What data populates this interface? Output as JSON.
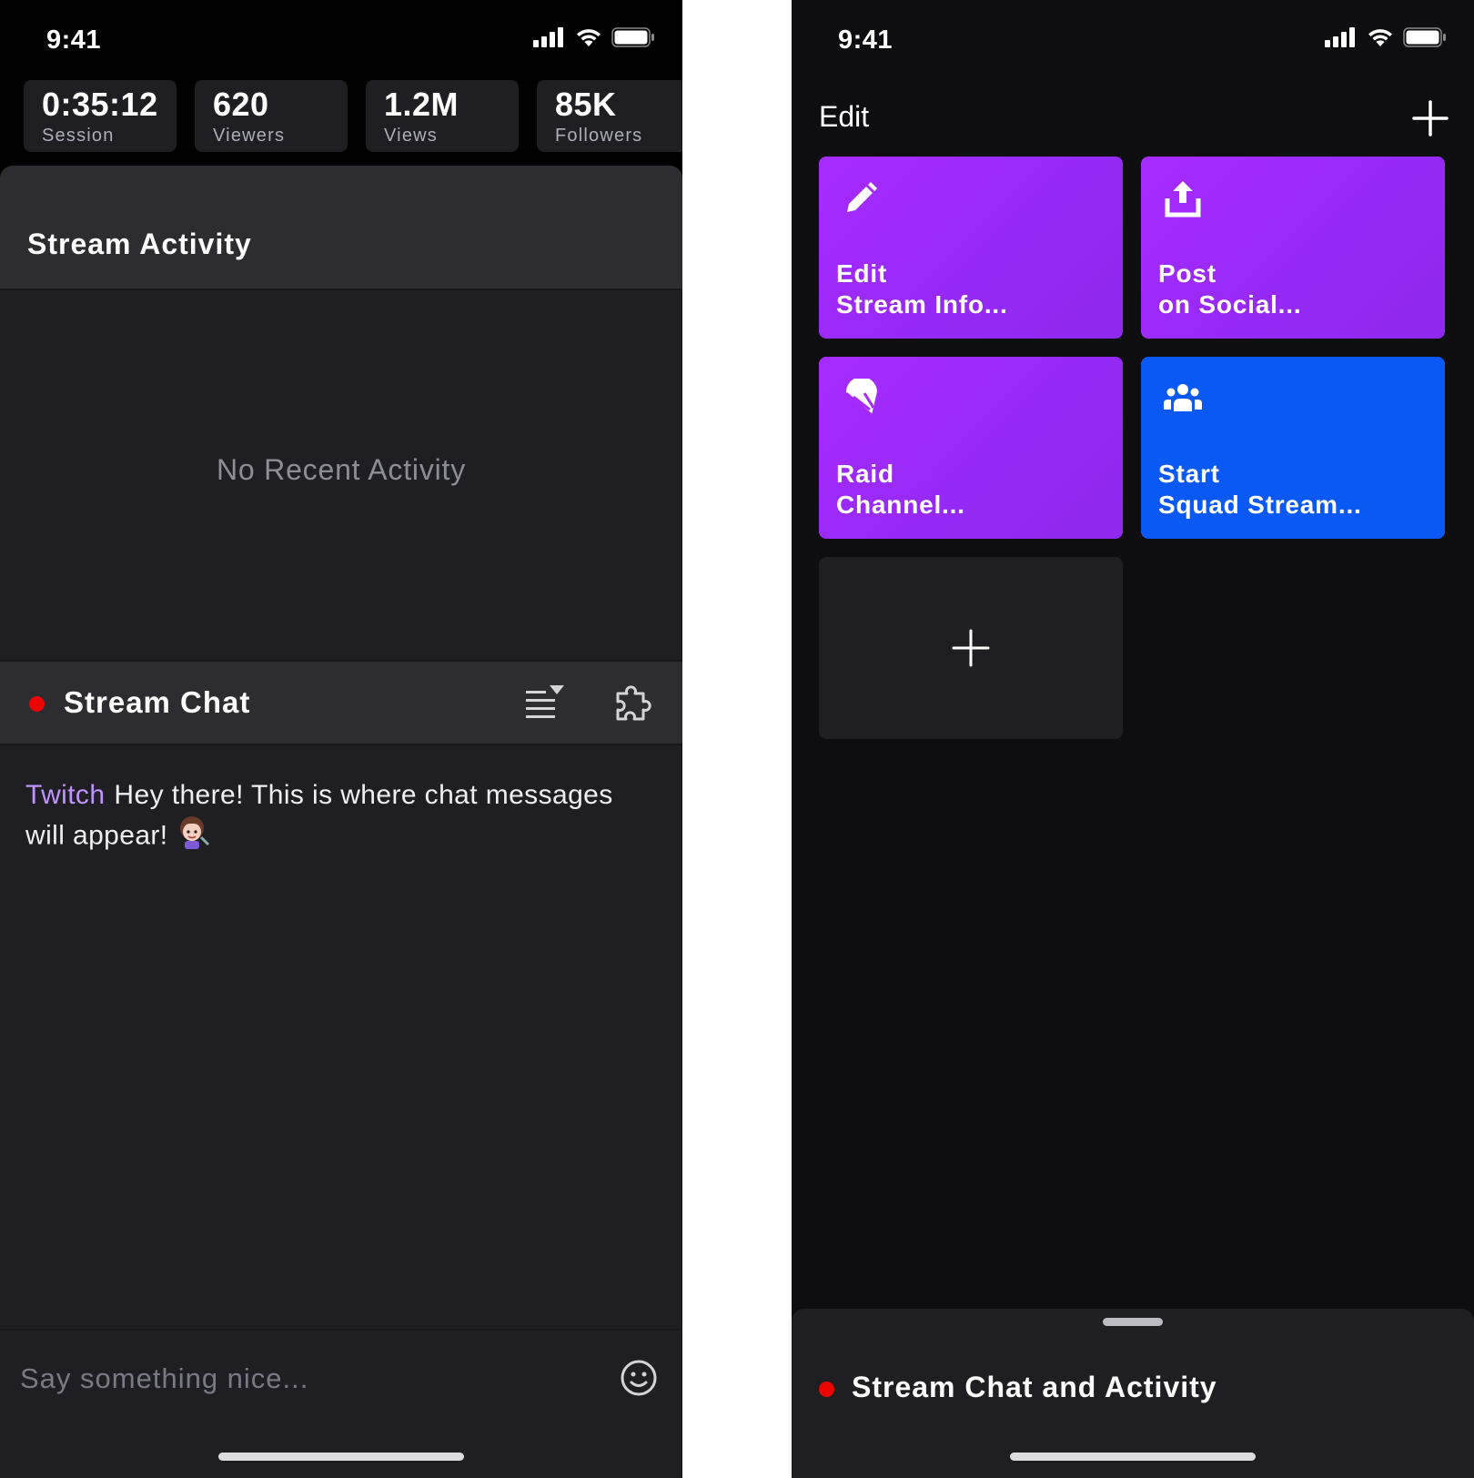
{
  "left_screen": {
    "status_bar": {
      "time": "9:41",
      "icons": [
        "cellular-signal-icon",
        "wifi-icon",
        "battery-icon"
      ]
    },
    "stats": [
      {
        "value": "0:35:12",
        "label": "Session"
      },
      {
        "value": "620",
        "label": "Viewers"
      },
      {
        "value": "1.2M",
        "label": "Views"
      },
      {
        "value": "85K",
        "label": "Followers"
      }
    ],
    "activity": {
      "title": "Stream Activity",
      "empty_text": "No Recent Activity"
    },
    "chat": {
      "title": "Stream Chat",
      "live_color": "#eb0400",
      "actions": [
        "chat-filter-icon",
        "extensions-puzzle-icon"
      ],
      "messages": [
        {
          "user": "Twitch",
          "user_color": "#bf94ff",
          "text": "Hey there! This is where chat messages will appear!",
          "emote": "emote-icon"
        }
      ],
      "input_placeholder": "Say something nice...",
      "emoji_button": "emoji-icon"
    }
  },
  "right_screen": {
    "status_bar": {
      "time": "9:41",
      "icons": [
        "cellular-signal-icon",
        "wifi-icon",
        "battery-icon"
      ]
    },
    "header": {
      "title": "Edit",
      "add_icon": "plus-icon"
    },
    "tiles": [
      {
        "label_line1": "Edit",
        "label_line2": "Stream Info...",
        "icon": "pencil-icon",
        "color": "#a72bff"
      },
      {
        "label_line1": "Post",
        "label_line2": "on Social...",
        "icon": "share-upload-icon",
        "color": "#a72bff"
      },
      {
        "label_line1": "Raid",
        "label_line2": "Channel...",
        "icon": "parachute-icon",
        "color": "#a72bff"
      },
      {
        "label_line1": "Start",
        "label_line2": "Squad Stream...",
        "icon": "squad-group-icon",
        "color": "#0a59f5"
      }
    ],
    "add_tile_icon": "plus-icon",
    "bottom_sheet": {
      "title": "Stream Chat and Activity",
      "live_color": "#eb0400"
    }
  },
  "colors": {
    "accent_purple": "#a72bff",
    "accent_blue": "#0a59f5",
    "live_red": "#eb0400",
    "chat_username": "#bf94ff"
  }
}
